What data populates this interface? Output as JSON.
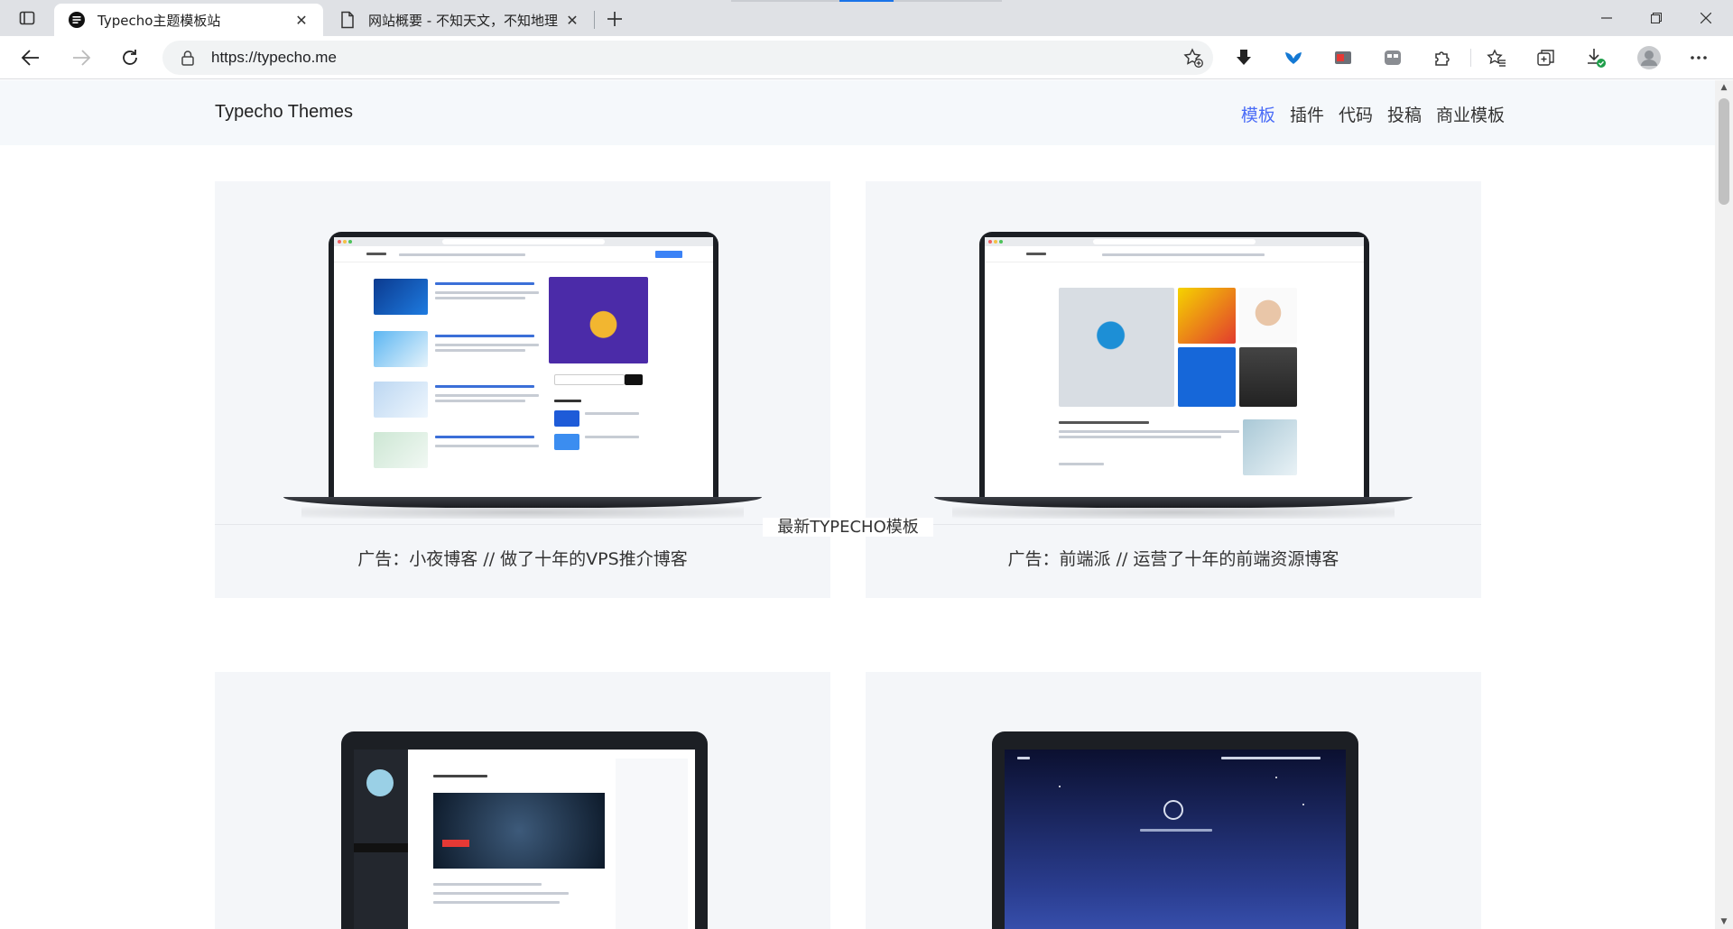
{
  "browser": {
    "tabs": [
      {
        "title": "Typecho主题模板站",
        "active": true
      },
      {
        "title": "网站概要 - 不知天文，不知地理",
        "active": false
      }
    ],
    "address": {
      "url": "https://typecho.me"
    }
  },
  "site": {
    "logo": "Typecho Themes",
    "nav": [
      {
        "label": "模板",
        "active": true
      },
      {
        "label": "插件",
        "active": false
      },
      {
        "label": "代码",
        "active": false
      },
      {
        "label": "投稿",
        "active": false
      },
      {
        "label": "商业模板",
        "active": false
      }
    ],
    "ads": [
      {
        "caption": "广告：小夜博客 // 做了十年的VPS推介博客"
      },
      {
        "caption": "广告：前端派 // 运营了十年的前端资源博客"
      }
    ],
    "section_title": "最新TYPECHO模板"
  },
  "colors": {
    "accent": "#4a6cf7",
    "header_bg": "#f5f8fb",
    "card_bg": "#f4f6f9"
  }
}
